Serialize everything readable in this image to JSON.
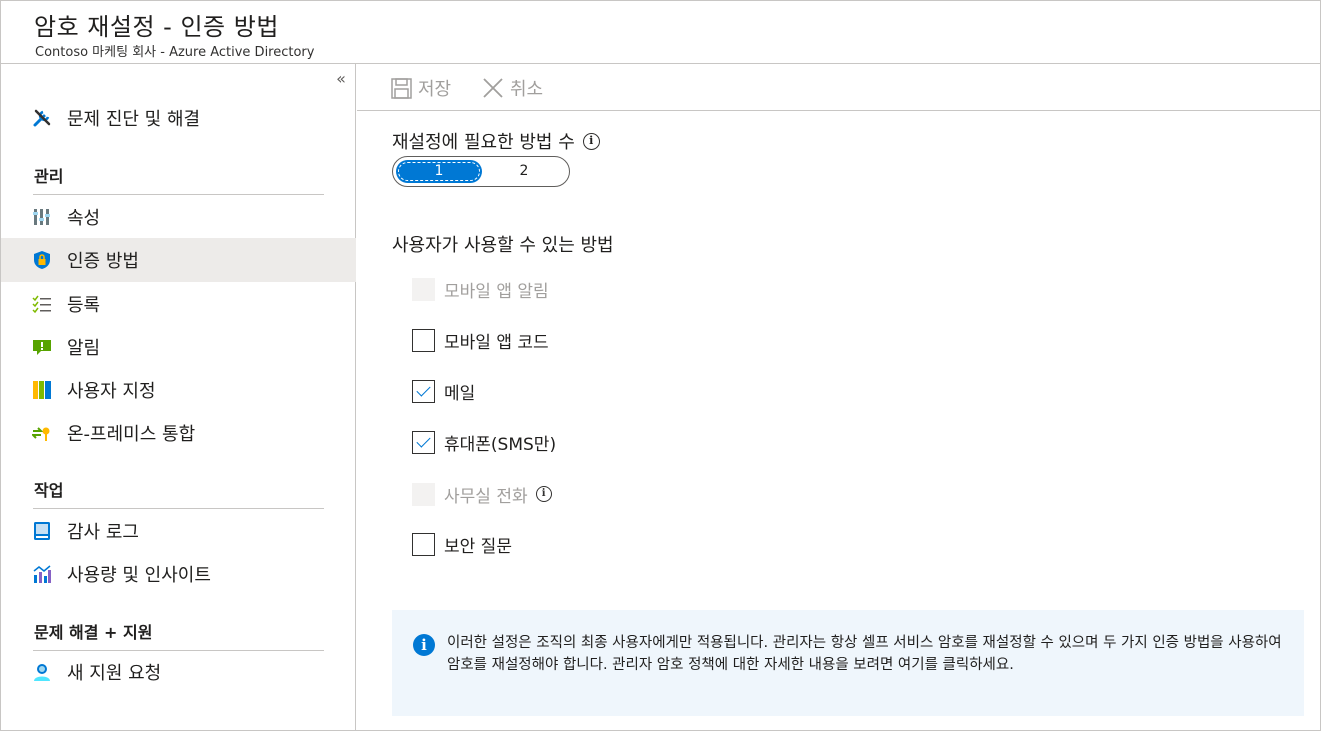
{
  "header": {
    "title": "암호 재설정 - 인증 방법",
    "subtitle": "Contoso 마케팅 회사 - Azure Active Directory"
  },
  "sidebar": {
    "collapse_glyph": "«",
    "troubleshoot": {
      "label": "문제 진단 및 해결",
      "icon": "wrench-screwdriver-icon"
    },
    "sections": [
      {
        "title": "관리",
        "items": [
          {
            "label": "속성",
            "icon": "properties-icon",
            "selected": false
          },
          {
            "label": "인증 방법",
            "icon": "shield-lock-icon",
            "selected": true
          },
          {
            "label": "등록",
            "icon": "checklist-icon",
            "selected": false
          },
          {
            "label": "알림",
            "icon": "notification-icon",
            "selected": false
          },
          {
            "label": "사용자 지정",
            "icon": "customize-icon",
            "selected": false
          },
          {
            "label": "온-프레미스 통합",
            "icon": "sync-key-icon",
            "selected": false
          }
        ]
      },
      {
        "title": "작업",
        "items": [
          {
            "label": "감사 로그",
            "icon": "audit-log-icon",
            "selected": false
          },
          {
            "label": "사용량 및 인사이트",
            "icon": "insights-chart-icon",
            "selected": false
          }
        ]
      },
      {
        "title": "문제 해결 + 지원",
        "items": [
          {
            "label": "새 지원 요청",
            "icon": "support-person-icon",
            "selected": false
          }
        ]
      }
    ]
  },
  "toolbar": {
    "save_label": "저장",
    "cancel_label": "취소"
  },
  "main": {
    "required_label": "재설정에 필요한 방법 수",
    "toggle": {
      "options": [
        "1",
        "2"
      ],
      "selected": "1"
    },
    "methods_title": "사용자가 사용할 수 있는 방법",
    "methods": [
      {
        "label": "모바일 앱 알림",
        "checked": false,
        "disabled": true
      },
      {
        "label": "모바일 앱 코드",
        "checked": false,
        "disabled": false
      },
      {
        "label": "메일",
        "checked": true,
        "disabled": false
      },
      {
        "label": "휴대폰(SMS만)",
        "checked": true,
        "disabled": false
      },
      {
        "label": "사무실 전화",
        "checked": false,
        "disabled": true
      },
      {
        "label": "보안 질문",
        "checked": false,
        "disabled": false
      }
    ],
    "notice": "이러한 설정은 조직의 최종 사용자에게만 적용됩니다. 관리자는 항상 셀프 서비스 암호를 재설정할 수 있으며 두 가지 인증 방법을 사용하여 암호를 재설정해야 합니다. 관리자 암호 정책에 대한 자세한 내용을 보려면 여기를 클릭하세요."
  },
  "colors": {
    "accent": "#0078d4",
    "selected_bg": "#edebe9",
    "notice_bg": "#eff6fc"
  }
}
